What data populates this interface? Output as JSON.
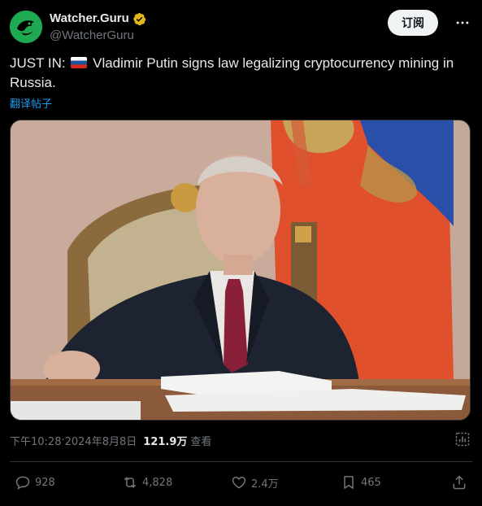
{
  "author": {
    "display_name": "Watcher.Guru",
    "handle": "@WatcherGuru"
  },
  "header": {
    "subscribe_label": "订阅",
    "more_label": "···"
  },
  "tweet": {
    "prefix": "JUST IN:",
    "flag_icon": "russia-flag-icon",
    "body": "Vladimir Putin signs law legalizing cryptocurrency mining in Russia.",
    "translate_label": "翻译帖子"
  },
  "meta": {
    "time": "下午10:28",
    "separator": " · ",
    "date": "2024年8月8日",
    "views_count": "121.9万",
    "views_label": "查看"
  },
  "actions": {
    "replies": "928",
    "retweets": "4,828",
    "likes": "2.4万",
    "bookmarks": "465"
  },
  "colors": {
    "background": "#000000",
    "text": "#e7e9ea",
    "muted": "#71767b",
    "link": "#1d9bf0",
    "verified_badge": "#e2b719",
    "avatar_bg": "#1d9b4b"
  }
}
